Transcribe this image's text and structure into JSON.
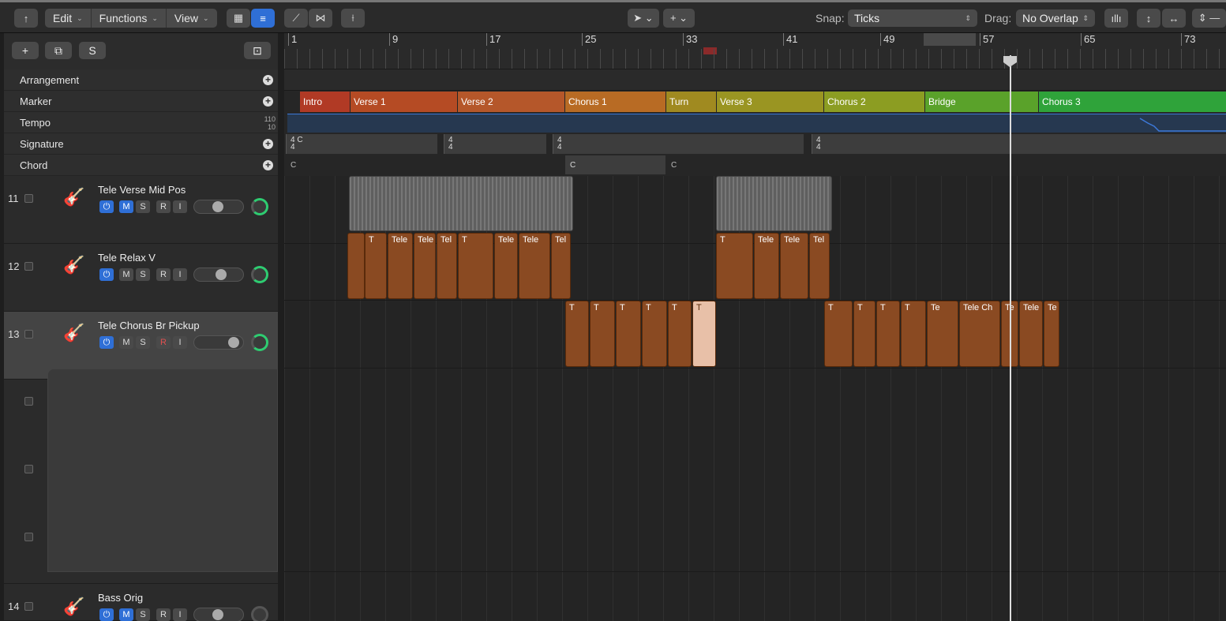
{
  "toolbar": {
    "edit": "Edit",
    "functions": "Functions",
    "view": "View",
    "snap_label": "Snap:",
    "snap_value": "Ticks",
    "drag_label": "Drag:",
    "drag_value": "No Overlap"
  },
  "header": {
    "add": "+",
    "s_button": "S"
  },
  "global_tracks": {
    "arrangement": "Arrangement",
    "marker": "Marker",
    "tempo": "Tempo",
    "tempo_max": "110",
    "tempo_min": "10",
    "signature": "Signature",
    "chord": "Chord"
  },
  "ruler": [
    "1",
    "9",
    "17",
    "25",
    "33",
    "41",
    "49",
    "57",
    "65",
    "73"
  ],
  "markers": [
    "Intro",
    "Verse 1",
    "Verse 2",
    "Chorus 1",
    "Turn",
    "Verse 3",
    "Chorus 2",
    "Bridge",
    "Chorus 3"
  ],
  "signature": {
    "num": "4",
    "den": "4",
    "key": "C"
  },
  "chords": [
    "C",
    "C",
    "C"
  ],
  "tracks": [
    {
      "num": "11",
      "name": "Tele Verse Mid Pos"
    },
    {
      "num": "12",
      "name": "Tele Relax V"
    },
    {
      "num": "13",
      "name": "Tele Chorus Br Pickup"
    },
    {
      "num": "14",
      "name": "Bass Orig"
    }
  ],
  "buttons": {
    "m": "M",
    "s": "S",
    "r": "R",
    "i": "I"
  },
  "region_names": {
    "t12": [
      "T",
      "Tele",
      "Tele",
      "Tel",
      "T",
      "Tele",
      "Tele",
      "Tel",
      "T",
      "Tele",
      "Tele",
      "Tel"
    ],
    "t13": [
      "T",
      "T",
      "T",
      "T",
      "T",
      "T",
      "T",
      "T",
      "T",
      "T",
      "T",
      "T",
      "Te",
      "Tele Ch",
      "Te",
      "Tele",
      "Te"
    ]
  }
}
